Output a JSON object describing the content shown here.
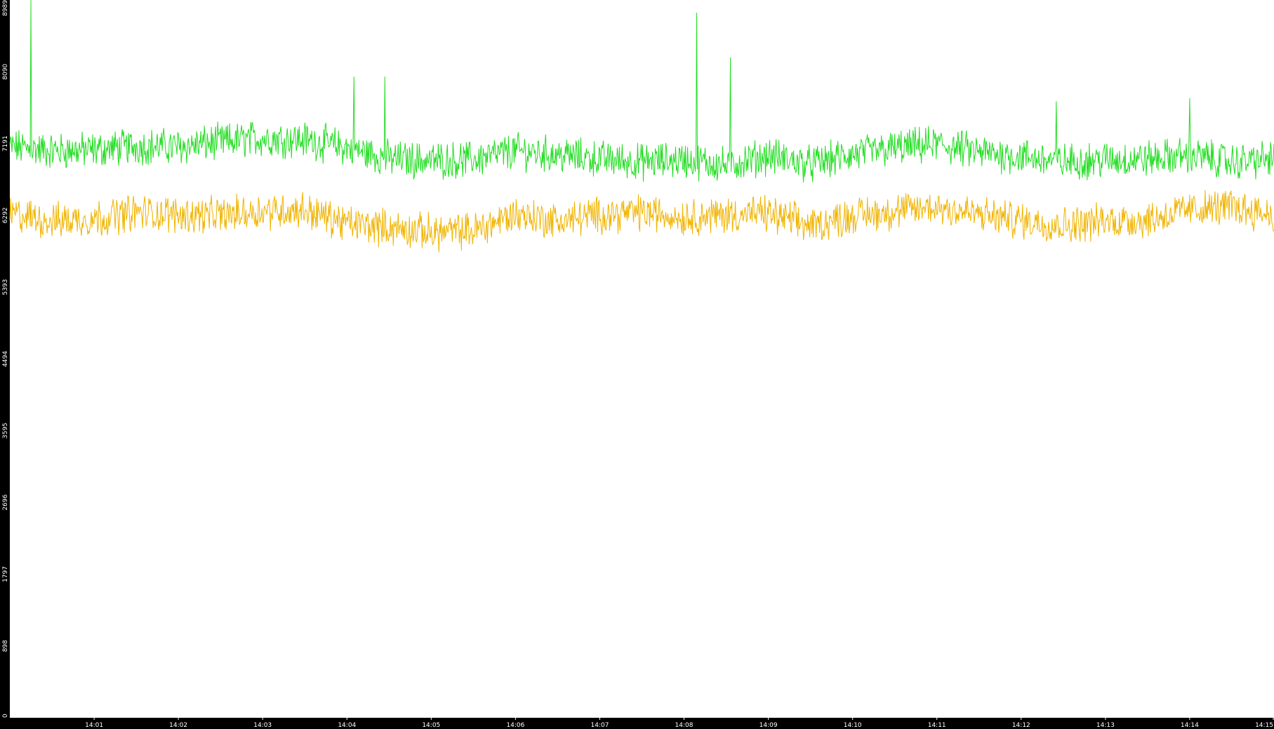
{
  "chart_data": {
    "type": "line",
    "title": "",
    "xlabel": "",
    "ylabel": "",
    "ylim": [
      0,
      8989
    ],
    "y_ticks": [
      "0",
      "898",
      "1797",
      "2696",
      "3595",
      "4494",
      "5393",
      "6292",
      "7191",
      "8090",
      "8989"
    ],
    "x_range": [
      "14:00",
      "14:15"
    ],
    "x_ticks": [
      "14:01",
      "14:02",
      "14:03",
      "14:04",
      "14:05",
      "14:06",
      "14:07",
      "14:08",
      "14:09",
      "14:10",
      "14:11",
      "14:12",
      "14:13",
      "14:14",
      "14:15"
    ],
    "grid": false,
    "legend": "none",
    "colors": {
      "background": "#000000",
      "plot_area": "#ffffff",
      "tick_text": "#ffffff"
    },
    "series": [
      {
        "color": "#22dd22",
        "x": [
          "14:00",
          "14:00:30",
          "14:01",
          "14:01:30",
          "14:02",
          "14:02:30",
          "14:03",
          "14:03:30",
          "14:04",
          "14:04:30",
          "14:05",
          "14:05:30",
          "14:06",
          "14:06:30",
          "14:07",
          "14:07:30",
          "14:08",
          "14:08:30",
          "14:09",
          "14:09:30",
          "14:10",
          "14:10:30",
          "14:11",
          "14:11:30",
          "14:12",
          "14:12:30",
          "14:13",
          "14:13:30",
          "14:14",
          "14:14:30",
          "14:15"
        ],
        "values": [
          7150,
          7100,
          7110,
          7160,
          7150,
          7210,
          7260,
          7240,
          7140,
          7000,
          6980,
          6990,
          7100,
          7050,
          7000,
          6960,
          6990,
          6920,
          7040,
          6930,
          7050,
          7130,
          7180,
          7080,
          7030,
          6960,
          6990,
          7000,
          7050,
          6960,
          7000
        ],
        "peaks": [
          {
            "x": "14:00:15",
            "value": 8989
          },
          {
            "x": "14:04:05",
            "value": 8030
          },
          {
            "x": "14:04:27",
            "value": 8030
          },
          {
            "x": "14:08:09",
            "value": 8830
          },
          {
            "x": "14:08:33",
            "value": 8270
          },
          {
            "x": "14:12:25",
            "value": 7720
          },
          {
            "x": "14:14:00",
            "value": 7760
          }
        ]
      },
      {
        "color": "#f0b400",
        "x": [
          "14:00",
          "14:00:30",
          "14:01",
          "14:01:30",
          "14:02",
          "14:02:30",
          "14:03",
          "14:03:30",
          "14:04",
          "14:04:30",
          "14:05",
          "14:05:30",
          "14:06",
          "14:06:30",
          "14:07",
          "14:07:30",
          "14:08",
          "14:08:30",
          "14:09",
          "14:09:30",
          "14:10",
          "14:10:30",
          "14:11",
          "14:11:30",
          "14:12",
          "14:12:30",
          "14:13",
          "14:13:30",
          "14:14",
          "14:14:30",
          "14:15"
        ],
        "values": [
          6310,
          6220,
          6250,
          6330,
          6300,
          6290,
          6350,
          6360,
          6190,
          6140,
          6080,
          6100,
          6310,
          6220,
          6300,
          6330,
          6270,
          6300,
          6310,
          6160,
          6290,
          6340,
          6400,
          6300,
          6230,
          6170,
          6220,
          6240,
          6360,
          6400,
          6300
        ],
        "peaks": []
      }
    ]
  }
}
